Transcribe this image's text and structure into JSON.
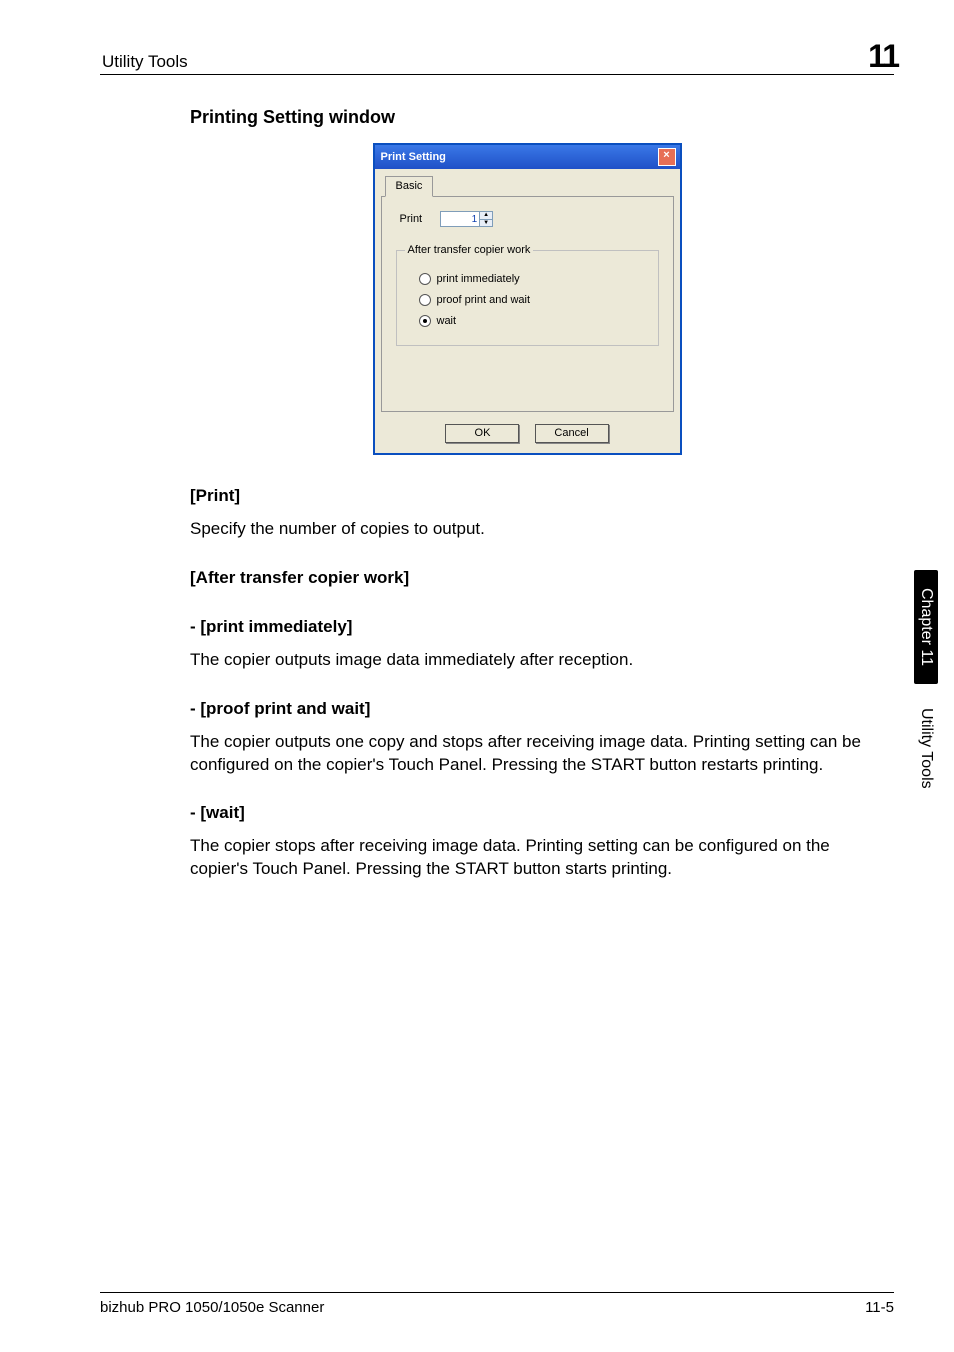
{
  "header": {
    "section": "Utility Tools",
    "chapter_number": "11"
  },
  "content": {
    "title": "Printing Setting window",
    "print_heading": "[Print]",
    "print_body": "Specify the number of copies to output.",
    "after_heading": "[After transfer copier work]",
    "opt1_heading": "- [print immediately]",
    "opt1_body": "The copier outputs image data immediately after reception.",
    "opt2_heading": "- [proof print and wait]",
    "opt2_body": "The copier outputs one copy and stops after receiving image data. Printing setting can be configured on the copier's Touch Panel. Pressing the START button restarts printing.",
    "opt3_heading": "- [wait]",
    "opt3_body": "The copier stops after receiving image data. Printing setting can be configured on the copier's Touch Panel. Pressing the START button starts printing."
  },
  "dialog": {
    "title": "Print Setting",
    "tab": "Basic",
    "print_label": "Print",
    "print_value": "1",
    "group_label": "After transfer copier work",
    "radio1": "print immediately",
    "radio2": "proof print and wait",
    "radio3": "wait",
    "ok": "OK",
    "cancel": "Cancel",
    "close": "×"
  },
  "side": {
    "chapter": "Chapter 11",
    "section": "Utility Tools"
  },
  "footer": {
    "left": "bizhub PRO 1050/1050e Scanner",
    "right": "11-5"
  }
}
